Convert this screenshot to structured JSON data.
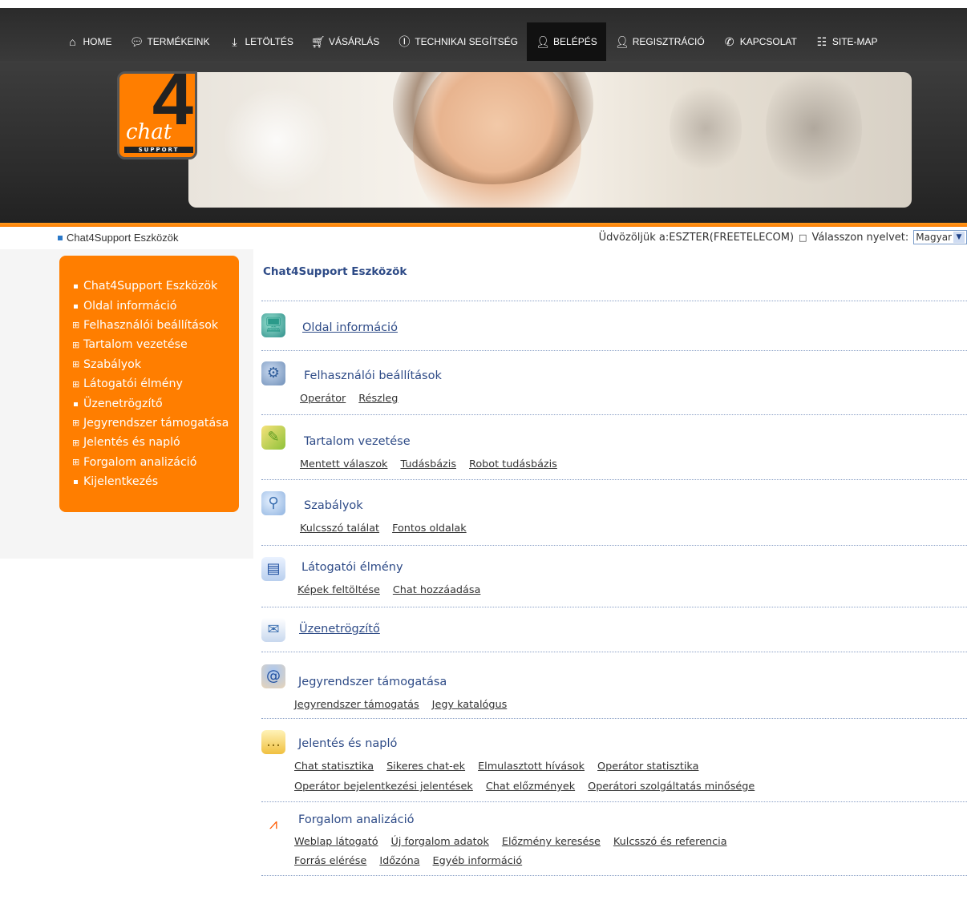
{
  "nav": {
    "items": [
      {
        "label": "HOME",
        "icon": "home-icon"
      },
      {
        "label": "TERMÉKEINK",
        "icon": "speech-bubble-icon"
      },
      {
        "label": "LETÖLTÉS",
        "icon": "download-icon"
      },
      {
        "label": "VÁSÁRLÁS",
        "icon": "cart-icon"
      },
      {
        "label": "TECHNIKAI SEGÍTSÉG",
        "icon": "info-icon"
      },
      {
        "label": "BELÉPÉS",
        "icon": "user-key-icon",
        "active": true
      },
      {
        "label": "REGISZTRÁCIÓ",
        "icon": "user-add-icon"
      },
      {
        "label": "KAPCSOLAT",
        "icon": "phone-icon"
      },
      {
        "label": "SITE-MAP",
        "icon": "sitemap-icon"
      }
    ]
  },
  "logo": {
    "four": "4",
    "chat": "chat",
    "support": "SUPPORT"
  },
  "breadcrumb": {
    "label": "Chat4Support Eszközök"
  },
  "welcome": {
    "text": "Üdvözöljük a:ESZTER(FREETELECOM)",
    "separator": "□",
    "language_label": "Válasszon nyelvet:",
    "language_value": "Magyar"
  },
  "sidebar": {
    "items": [
      {
        "label": "Chat4Support Eszközök",
        "marker": "bullet"
      },
      {
        "label": "Oldal információ",
        "marker": "bullet"
      },
      {
        "label": "Felhasználói beállítások",
        "marker": "plus"
      },
      {
        "label": "Tartalom vezetése",
        "marker": "plus"
      },
      {
        "label": "Szabályok",
        "marker": "plus"
      },
      {
        "label": "Látogatói élmény",
        "marker": "plus"
      },
      {
        "label": "Üzenetrögzítő",
        "marker": "bullet"
      },
      {
        "label": "Jegyrendszer támogatása",
        "marker": "plus"
      },
      {
        "label": "Jelentés és napló",
        "marker": "plus"
      },
      {
        "label": "Forgalom analizáció",
        "marker": "plus"
      },
      {
        "label": "Kijelentkezés",
        "marker": "bullet"
      }
    ]
  },
  "main": {
    "title": "Chat4Support Eszközök",
    "sections": [
      {
        "title": "Oldal információ",
        "icon": "monitor-icon",
        "links": []
      },
      {
        "title": "Felhasználói beállítások",
        "icon": "user-settings-icon",
        "links": [
          "Operátor",
          "Részleg"
        ]
      },
      {
        "title": "Tartalom vezetése",
        "icon": "edit-content-icon",
        "links": [
          "Mentett válaszok",
          "Tudásbázis",
          "Robot tudásbázis"
        ]
      },
      {
        "title": "Szabályok",
        "icon": "magnifier-icon",
        "links": [
          "Kulcsszó találat",
          "Fontos oldalak"
        ]
      },
      {
        "title": "Látogatói élmény",
        "icon": "id-card-icon",
        "links": [
          "Képek feltöltése",
          "Chat hozzáadása"
        ]
      },
      {
        "title": "Üzenetrögzítő",
        "icon": "mail-icon",
        "links": []
      },
      {
        "title": "Jegyrendszer támogatása",
        "icon": "handshake-icon",
        "links": [
          "Jegyrendszer támogatás",
          "Jegy katalógus"
        ]
      },
      {
        "title": "Jelentés és napló",
        "icon": "chat-bubbles-icon",
        "links": [
          "Chat statisztika",
          "Sikeres chat-ek",
          "Elmulasztott hívások",
          "Operátor statisztika"
        ],
        "links2": [
          "Operátor bejelentkezési jelentések",
          "Chat előzmények",
          "Operátori szolgáltatás minősége"
        ]
      },
      {
        "title": "Forgalom analizáció",
        "icon": "trend-icon",
        "links": [
          "Weblap látogató",
          "Új forgalom adatok",
          "Előzmény keresése",
          "Kulcsszó és referencia"
        ],
        "links2": [
          "Forrás elérése",
          "Időzóna",
          "Egyéb információ"
        ]
      }
    ]
  }
}
